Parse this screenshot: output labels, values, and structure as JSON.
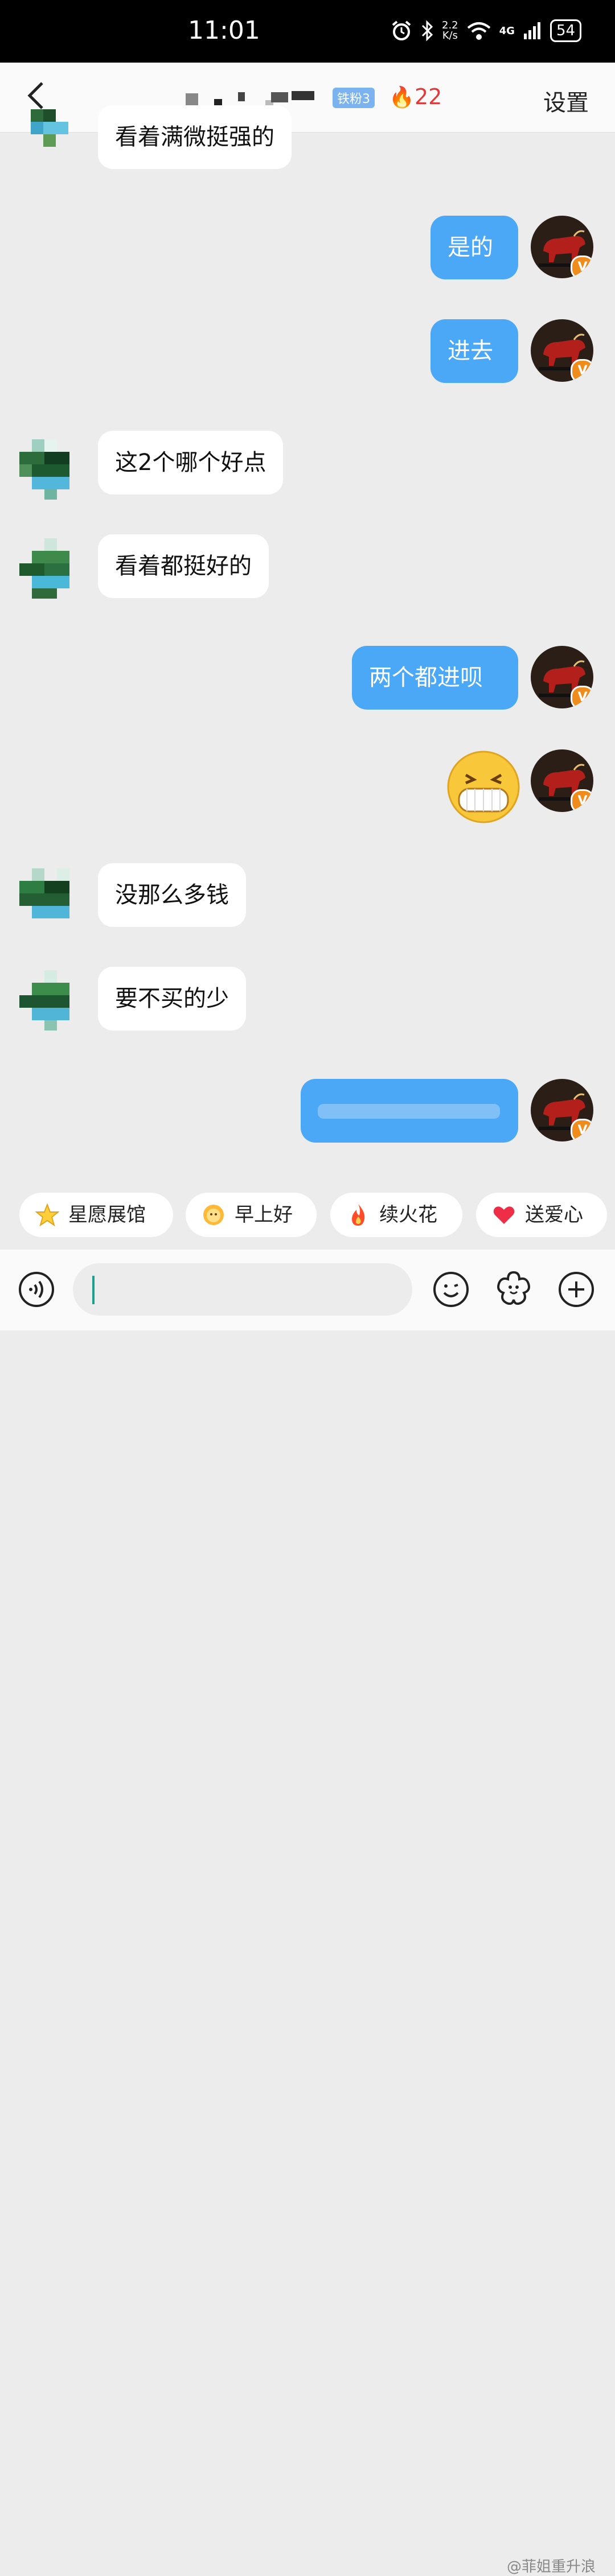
{
  "status_bar": {
    "time": "11:01",
    "net_speed_top": "2.2",
    "net_speed_bottom": "K/s",
    "network": "4G",
    "battery": "54",
    "icons": [
      "alarm-icon",
      "bluetooth-icon",
      "wifi-icon",
      "signal-icon",
      "battery-icon"
    ]
  },
  "header": {
    "back_icon": "chevron-left-icon",
    "fan_badge": "铁粉3",
    "spark_count": "22",
    "settings_label": "设置"
  },
  "messages": [
    {
      "side": "in",
      "text": "看着满微挺强的"
    },
    {
      "side": "out",
      "text": "是的"
    },
    {
      "side": "out",
      "text": "进去"
    },
    {
      "side": "in",
      "text": "这2个哪个好点"
    },
    {
      "side": "in",
      "text": "看着都挺好的"
    },
    {
      "side": "out",
      "text": "两个都进呗"
    },
    {
      "side": "out",
      "type": "emoji",
      "emoji": "grinning-face"
    },
    {
      "side": "in",
      "text": "没那么多钱"
    },
    {
      "side": "in",
      "text": "要不买的少"
    },
    {
      "side": "out",
      "text": ""
    }
  ],
  "verified_badge": "V",
  "quick_replies": [
    {
      "label": "星愿展馆",
      "icon": "star-icon"
    },
    {
      "label": "早上好",
      "icon": "sun-face-icon"
    },
    {
      "label": "续火花",
      "icon": "flame-icon"
    },
    {
      "label": "送爱心",
      "icon": "heart-icon"
    }
  ],
  "input_bar": {
    "voice_icon": "voice-icon",
    "emoji_icon": "smile-icon",
    "sticker_icon": "flower-icon",
    "add_icon": "plus-circle-icon",
    "value": ""
  },
  "watermark": "@菲姐重升浪",
  "colors": {
    "outgoing_bubble": "#4ba8f7",
    "incoming_bubble": "#ffffff",
    "background": "#ececec",
    "spark_count": "#e23a3a",
    "verified_badge": "#f08c1c"
  }
}
